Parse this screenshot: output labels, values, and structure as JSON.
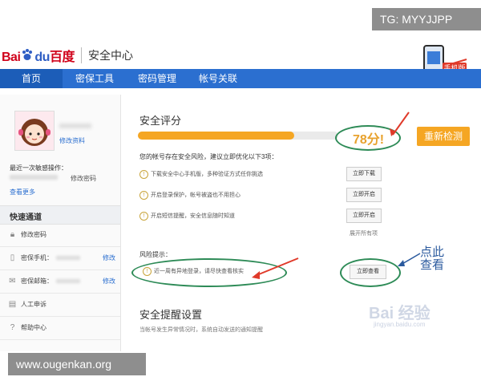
{
  "watermarks": {
    "top": "TG: MYYJJPP",
    "bottom": "www.ougenkan.org",
    "baidu": "Bai 经验",
    "baidu_url": "jingyan.baidu.com"
  },
  "header": {
    "logo_red": "Bai",
    "logo_blue": "du",
    "logo_cn": "百度",
    "site_title": "安全中心",
    "phone_badge": "手机版"
  },
  "nav": {
    "items": [
      {
        "label": "首页"
      },
      {
        "label": "密保工具"
      },
      {
        "label": "密码管理"
      },
      {
        "label": "帐号关联"
      }
    ]
  },
  "sidebar": {
    "edit_profile": "修改资料",
    "last_login_label": "最近一次敏感操作：",
    "change_pwd": "修改密码",
    "view_more": "查看更多",
    "quick_title": "快速通道",
    "items": [
      {
        "label": "修改密码",
        "edit": ""
      },
      {
        "label": "密保手机：",
        "edit": "修改"
      },
      {
        "label": "密保邮箱：",
        "edit": "修改"
      },
      {
        "label": "人工申诉",
        "edit": ""
      },
      {
        "label": "帮助中心",
        "edit": ""
      }
    ]
  },
  "score": {
    "title": "安全评分",
    "value": "78分!",
    "percent": 78,
    "recheck": "重新检测",
    "summary": "您的帐号存在安全风险，建议立即优化以下3项："
  },
  "suggestions": [
    {
      "text": "下载安全中心手机版，多种验证方式任你挑选",
      "button": "立即下载"
    },
    {
      "text": "开启登录保护，帐号被盗也不用担心",
      "button": "立即开启"
    },
    {
      "text": "开启短信提醒，安全信息随时知道",
      "button": "立即开启"
    }
  ],
  "expand_all": "展开所有项",
  "risk": {
    "title": "风险提示：",
    "text": "近一周有异地登录，请尽快查看核实",
    "button": "立即查看"
  },
  "annotation": "点此查看",
  "reminder": {
    "title": "安全提醒设置",
    "desc": "当帐号发生异常情况时，系统自动发送的通知提醒"
  },
  "colors": {
    "nav_blue": "#2b6fd0",
    "accent_orange": "#f5a623",
    "annotation_green": "#2e8b57",
    "arrow_red": "#e03a2a"
  }
}
